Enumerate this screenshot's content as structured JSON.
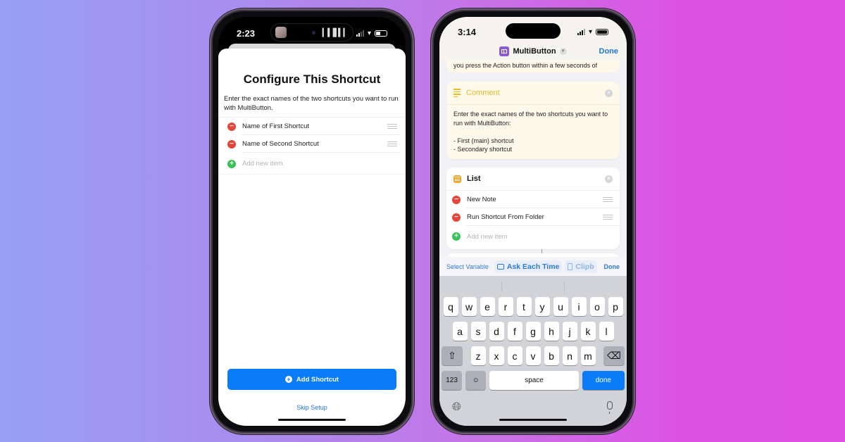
{
  "phone_left": {
    "status": {
      "time": "2:23"
    },
    "sheet": {
      "title": "Configure This Shortcut",
      "description": "Enter the exact names of the two shortcuts you want to run with MultiButton.",
      "items": [
        {
          "label": "Name of First Shortcut"
        },
        {
          "label": "Name of Second Shortcut"
        }
      ],
      "add_item_placeholder": "Add new item",
      "primary_button": "Add Shortcut",
      "secondary_link": "Skip Setup"
    }
  },
  "phone_right": {
    "status": {
      "time": "3:14"
    },
    "nav": {
      "title": "MultiButton",
      "done": "Done"
    },
    "partial_text": "you press the Action button within a few seconds of",
    "comment_card": {
      "title": "Comment",
      "body": "Enter the exact names of the two shortcuts you want to run with MultiButton:\n\n- First (main) shortcut\n- Secondary shortcut"
    },
    "list_card": {
      "title": "List",
      "items": [
        {
          "label": "New Note"
        },
        {
          "label": "Run Shortcut From Folder"
        }
      ],
      "add_item_placeholder": "Add new item"
    },
    "accessory": {
      "select_variable": "Select Variable",
      "ask_each_time": "Ask Each Time",
      "clipboard": "Clipb",
      "done": "Done"
    },
    "keyboard": {
      "row1": [
        "q",
        "w",
        "e",
        "r",
        "t",
        "y",
        "u",
        "i",
        "o",
        "p"
      ],
      "row2": [
        "a",
        "s",
        "d",
        "f",
        "g",
        "h",
        "j",
        "k",
        "l"
      ],
      "row3": [
        "z",
        "x",
        "c",
        "v",
        "b",
        "n",
        "m"
      ],
      "numbers": "123",
      "space": "space",
      "done": "done"
    }
  }
}
